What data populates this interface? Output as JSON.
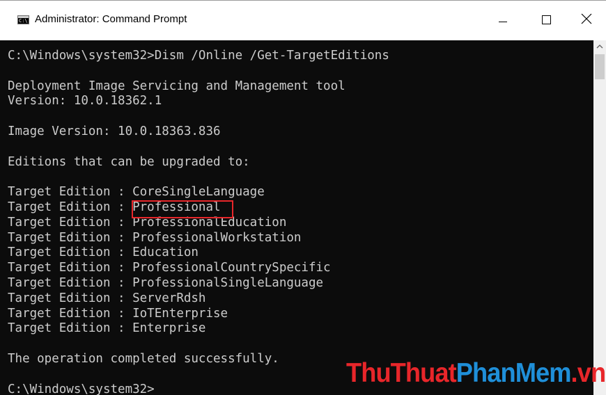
{
  "window": {
    "title": "Administrator: Command Prompt",
    "icon_text": "C:\\",
    "controls": {
      "minimize": "minimize-icon",
      "maximize": "maximize-icon",
      "close": "close-icon"
    }
  },
  "console": {
    "lines": [
      "C:\\Windows\\system32>Dism /Online /Get-TargetEditions",
      "",
      "Deployment Image Servicing and Management tool",
      "Version: 10.0.18362.1",
      "",
      "Image Version: 10.0.18363.836",
      "",
      "Editions that can be upgraded to:",
      "",
      "Target Edition : CoreSingleLanguage",
      "Target Edition : Professional",
      "Target Edition : ProfessionalEducation",
      "Target Edition : ProfessionalWorkstation",
      "Target Edition : Education",
      "Target Edition : ProfessionalCountrySpecific",
      "Target Edition : ProfessionalSingleLanguage",
      "Target Edition : ServerRdsh",
      "Target Edition : IoTEnterprise",
      "Target Edition : Enterprise",
      "",
      "The operation completed successfully.",
      "",
      "C:\\Windows\\system32>"
    ],
    "highlighted": "Professional",
    "colors": {
      "background": "#0c0c0c",
      "text": "#cccccc",
      "highlight": "#e8262a"
    }
  },
  "scrollbar": {
    "up_arrow": "chevron-up-icon"
  },
  "watermark": {
    "part1": "ThuThuat",
    "part2": "PhanMem",
    "part3": ".vn",
    "colors": {
      "primary": "#e8262a",
      "secondary": "#1f8fd9"
    }
  }
}
